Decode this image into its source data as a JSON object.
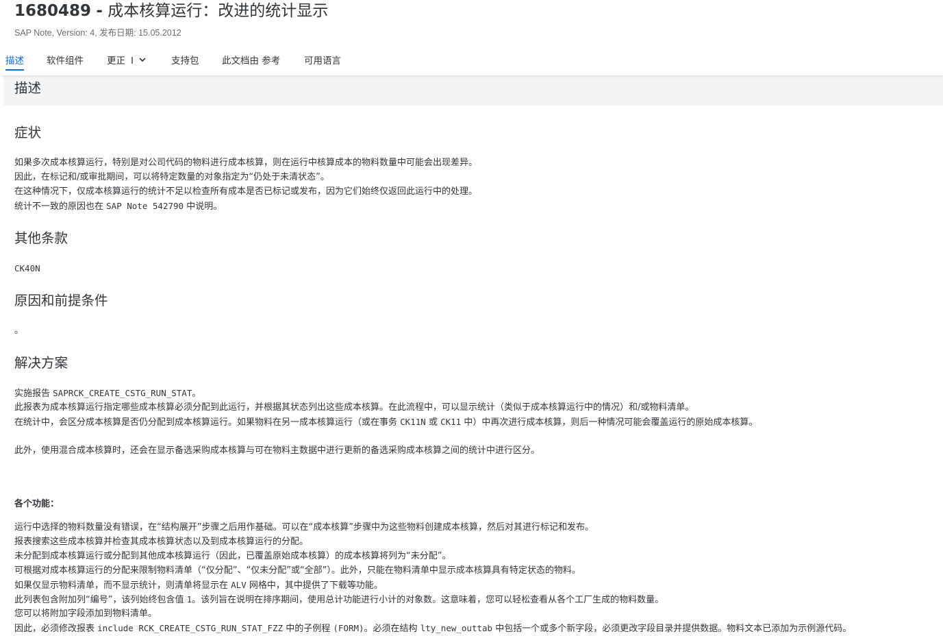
{
  "note": {
    "id": "1680489",
    "separator": "-",
    "title": "成本核算运行：改进的统计显示",
    "subtitle": "SAP Note, Version: 4, 发布日期: 15.05.2012"
  },
  "tabs": [
    {
      "label": "描述",
      "active": true
    },
    {
      "label": "软件组件"
    },
    {
      "label": "更正",
      "count": "I"
    },
    {
      "label": "支持包"
    },
    {
      "label": "此文档由 参考"
    },
    {
      "label": "可用语言"
    }
  ],
  "section_title": "描述",
  "symptom": {
    "heading": "症状",
    "lines": [
      "如果多次成本核算运行，特别是对公司代码的物料进行成本核算，则在运行中核算成本的物料数量中可能会出现差异。",
      "因此，在标记和/或审批期间，可以将特定数量的对象指定为“仍处于未清状态”。",
      "在这种情况下，仅成本核算运行的统计不足以检查所有成本是否已标记或发布，因为它们始终仅返回此运行中的处理。",
      "统计不一致的原因也在",
      "SAP Note 542790",
      "中说明。"
    ]
  },
  "other_terms": {
    "heading": "其他条款",
    "text": "CK40N"
  },
  "reason": {
    "heading": "原因和前提条件",
    "text": "。"
  },
  "solution": {
    "heading": "解决方案",
    "line1_a": "实施报告",
    "line1_b": "SAPRCK_CREATE_CSTG_RUN_STAT",
    "line1_c": "。",
    "line2": "此报表为成本核算运行指定哪些成本核算必须分配到此运行，并根据其状态列出这些成本核算。在此流程中，可以显示统计（类似于成本核算运行中的情况）和/或物料清单。",
    "line3_a": "在统计中，会区分成本核算是否仍分配到成本核算运行。如果物料在另一成本核算运行（或在事务",
    "line3_b": "CK11N",
    "line3_c": "或",
    "line3_d": "CK11",
    "line3_e": "中）中再次进行成本核算，则后一种情况可能会覆盖运行的原始成本核算。",
    "line4": "此外，使用混合成本核算时，还会在显示备选采购成本核算与可在物料主数据中进行更新的备选采购成本核算之间的统计中进行区分。",
    "functions_heading": "各个功能：",
    "f1": "运行中选择的物料数量没有错误，在“结构展开”步骤之后用作基础。可以在“成本核算”步骤中为这些物料创建成本核算，然后对其进行标记和发布。",
    "f2": "报表搜索这些成本核算并检查其成本核算状态以及到成本核算运行的分配。",
    "f3": "未分配到成本核算运行或分配到其他成本核算运行（因此，已覆盖原始成本核算）的成本核算将列为“未分配”。",
    "f4": "可根据对成本核算运行的分配来限制物料清单（“仅分配”、“仅未分配”或“全部”）。此外，只能在物料清单中显示成本核算具有特定状态的物料。",
    "f5_a": "如果仅显示物料清单，而不显示统计，则清单将显示在",
    "f5_b": "ALV",
    "f5_c": "网格中，其中提供了下载等功能。",
    "f6_a": "此列表包含附加列“编号”，该列始终包含值",
    "f6_b": "1",
    "f6_c": "。该列旨在说明在排序期间，使用总计功能进行小计的对象数。这意味着，您可以轻松查看从各个工厂生成的物料数量。",
    "f7": "您可以将附加字段添加到物料清单。",
    "f8_a": "因此，必须修改报表",
    "f8_b": "include RCK_CREATE_CSTG_RUN_STAT_FZZ",
    "f8_c": "中的子例程",
    "f8_d": "(FORM)",
    "f8_e": "。必须在结构",
    "f8_f": "lty_new_outtab",
    "f8_g": "中包括一个或多个新字段，必须更改字段目录并提供数据。物料文本已添加为示例源代码。"
  },
  "colors": {
    "accent": "#0a6ed1",
    "text": "#32363a",
    "subtle": "#6a6d70",
    "section_bg": "#f3f4f5"
  }
}
